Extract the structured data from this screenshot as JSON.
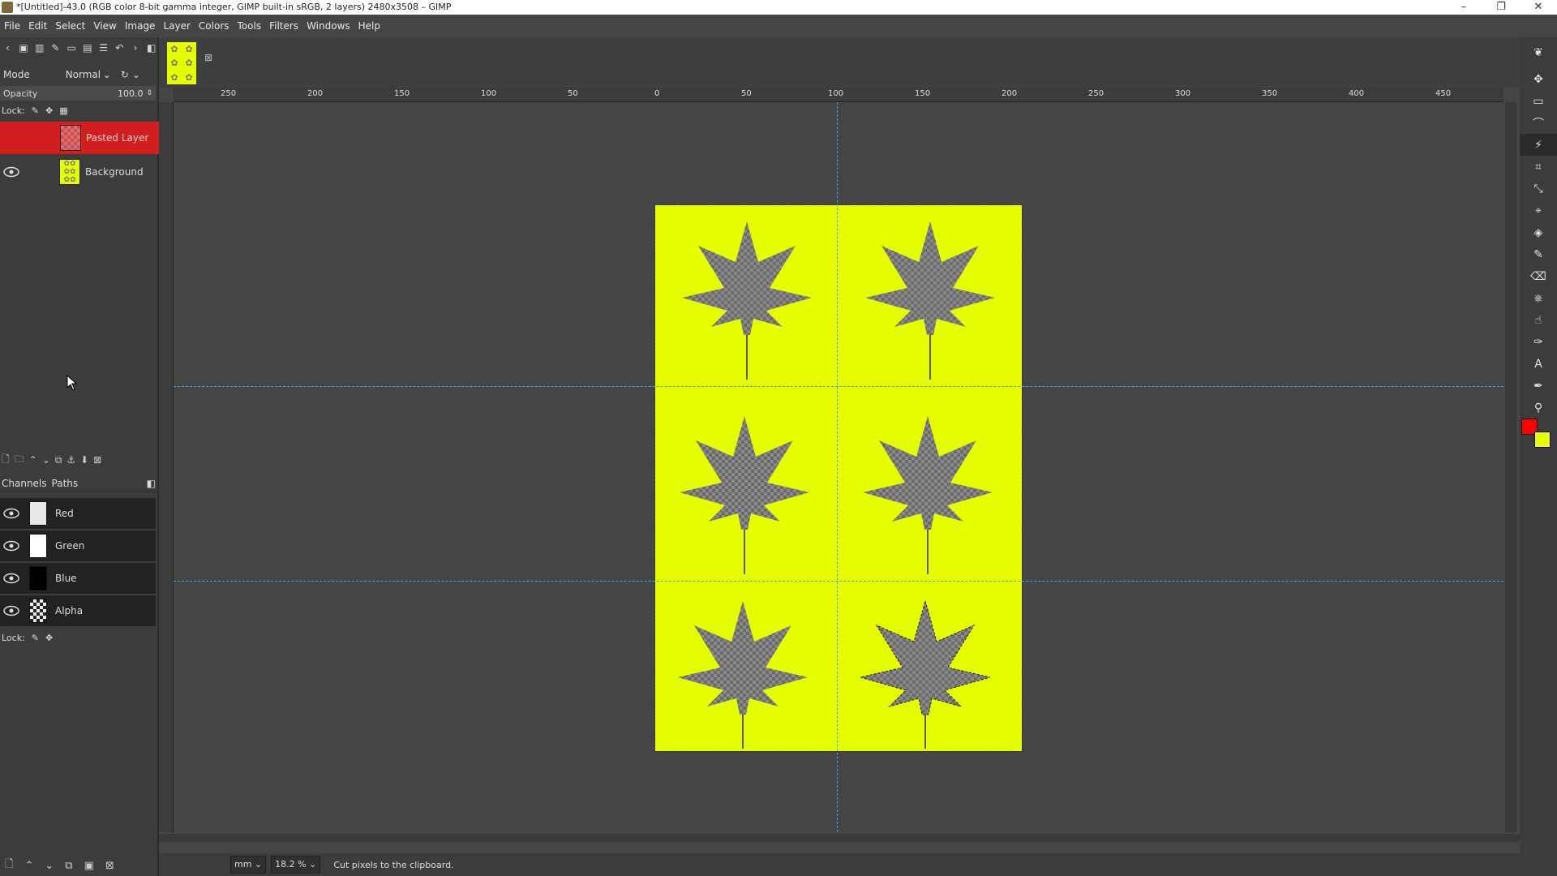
{
  "window": {
    "title": "*[Untitled]-43.0 (RGB color 8-bit gamma integer, GIMP built-in sRGB, 2 layers) 2480x3508 – GIMP",
    "minimize": "–",
    "restore": "❐",
    "close": "✕"
  },
  "menu": [
    "File",
    "Edit",
    "Select",
    "View",
    "Image",
    "Layer",
    "Colors",
    "Tools",
    "Filters",
    "Windows",
    "Help"
  ],
  "layers_panel": {
    "mode_label": "Mode",
    "mode_value": "Normal",
    "opacity_label": "Opacity",
    "opacity_value": "100.0",
    "lock_label": "Lock:",
    "layers": [
      {
        "name": "Pasted Layer",
        "selected": true,
        "visible": false
      },
      {
        "name": "Background",
        "selected": false,
        "visible": true
      }
    ]
  },
  "channels_panel": {
    "tab_channels": "Channels",
    "tab_paths": "Paths",
    "channels": [
      {
        "name": "Red",
        "thumb_color": "#e8e8e8"
      },
      {
        "name": "Green",
        "thumb_color": "#ffffff"
      },
      {
        "name": "Blue",
        "thumb_color": "#000000"
      },
      {
        "name": "Alpha",
        "thumb_color": "#222222"
      }
    ],
    "lock_label": "Lock:"
  },
  "ruler": {
    "h_labels": [
      "250",
      "200",
      "150",
      "100",
      "50",
      "0",
      "50",
      "100",
      "150",
      "200",
      "250",
      "300",
      "350",
      "400",
      "450"
    ]
  },
  "colors": {
    "foreground": "#ff0000",
    "background": "#e5ff00",
    "selected_layer": "#d11e1e",
    "guide": "#4aa0e0"
  },
  "statusbar": {
    "unit": "mm",
    "zoom": "18.2 %",
    "message": "Cut pixels to the clipboard."
  }
}
